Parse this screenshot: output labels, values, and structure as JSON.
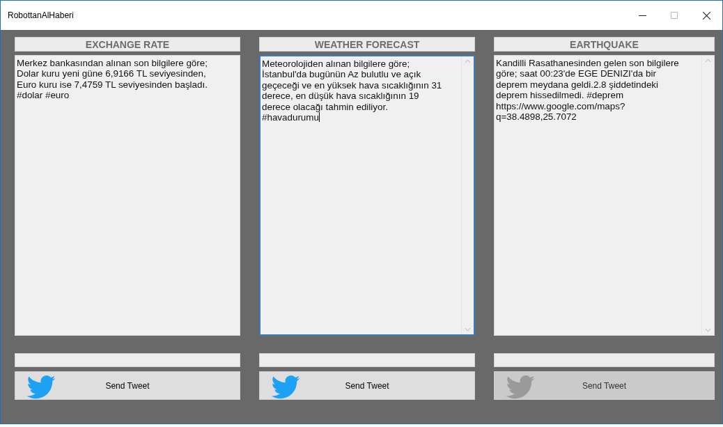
{
  "window": {
    "title": "RobottanAlHaberi"
  },
  "panels": [
    {
      "title": "EXCHANGE RATE",
      "text": "Merkez bankasından alınan son bilgilere göre;\nDolar kuru yeni güne 6,9166 TL seviyesinden,\nEuro kuru ise 7,4759 TL seviyesinden başladı.\n#dolar #euro",
      "focused": false,
      "scrollbar": false,
      "button": {
        "label": "Send Tweet",
        "disabled": false
      }
    },
    {
      "title": "WEATHER FORECAST",
      "text": "Meteorolojiden alınan bilgilere göre;\nİstanbul'da bugünün Az bulutlu ve açık\ngeçeceği ve en yüksek hava sıcaklığının 31\nderece, en düşük hava sıcaklığının 19\nderece olacağı tahmin ediliyor.\n#havadurumu",
      "focused": true,
      "scrollbar": true,
      "button": {
        "label": "Send Tweet",
        "disabled": false
      }
    },
    {
      "title": "EARTHQUAKE",
      "text": "Kandilli Rasathanesinden gelen son bilgilere\ngöre; saat 00:23'de EGE DENIZI'da bir\ndeprem meydana geldi.2.8 şiddetindeki\ndeprem hissedilmedi. #deprem\nhttps://www.google.com/maps?\nq=38.4898,25.7072",
      "focused": false,
      "scrollbar": true,
      "button": {
        "label": "Send Tweet",
        "disabled": true
      }
    }
  ]
}
